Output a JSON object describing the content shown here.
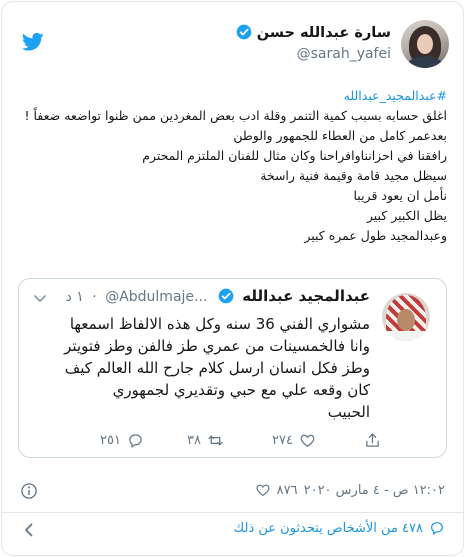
{
  "author": {
    "name": "سارة عبدالله حسن",
    "handle": "@sarah_yafei",
    "verified": true
  },
  "tweet": {
    "hashtag": "#عبدالمجيد_عبدالله",
    "lines": [
      "اغلق حسابه بسبب كمية التنمر وقلة ادب بعض المغردين ممن ظنوا تواضعه ضعفاً !",
      "بعدعمر كامل من العطاء للجمهور والوطن",
      "رافقنا في احزانناوافراحنا وكان مثال للفنان الملتزم المحترم",
      "سيظل مجيد قامة وقيمة فنية راسخة",
      "نأمل ان يعود قريبا",
      "يظل الكبير كبير",
      "وعبدالمجيد طول عمره كبير"
    ]
  },
  "quoted": {
    "name": "عبدالمجيد عبدالله",
    "handle": "@Abdulmaje...",
    "dot": "·",
    "time": "١ د",
    "lines": [
      "مشواري الفني 36 سنه وكل هذه الالفاظ اسمعها",
      "وانا فالخمسينات من عمري طز فالفن وطز فتويتر",
      "وطز فكل انسان ارسل كلام جارح الله العالم كيف",
      "كان وقعه علي مع حبي وتقديري لجمهوري",
      "الحبيب"
    ],
    "replies": "٢٥١",
    "retweets": "٣٨",
    "likes": "٢٧٤"
  },
  "meta": {
    "likes": "٨٧٦",
    "timestamp": "١٢:٠٢ ص - ٤ مارس ٢٠٢٠"
  },
  "footer": {
    "link_text": "٤٧٨ من الأشخاص يتحدثون عن ذلك"
  },
  "colors": {
    "link": "#1b95e0",
    "muted": "#657786",
    "border": "#e1e8ed",
    "verified": "#1da1f2"
  },
  "icons": [
    "twitter-bird-icon",
    "verified-badge-icon",
    "chevron-down-icon",
    "reply-icon",
    "retweet-icon",
    "like-icon",
    "share-icon",
    "info-icon",
    "heart-icon",
    "chevron-left-icon",
    "speech-bubble-icon"
  ]
}
